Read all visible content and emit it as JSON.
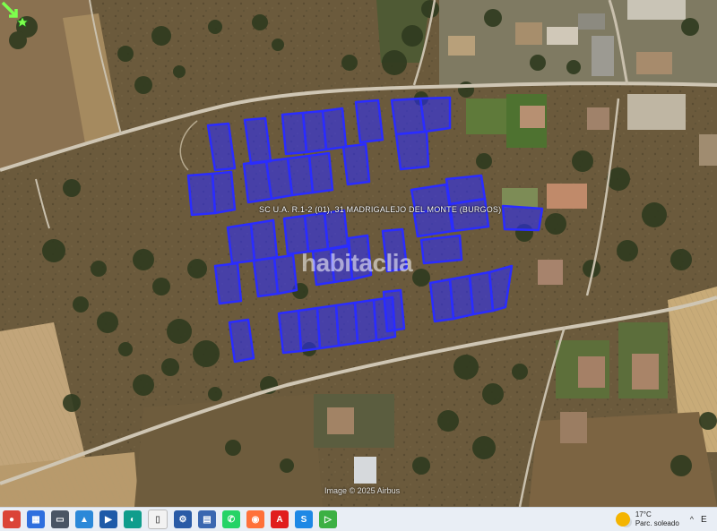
{
  "map": {
    "parcel_label": "SC U.A. R.1-2 (01), 31  MADRIGALEJO DEL MONTE (BURGOS)",
    "watermark": "habitaclia",
    "copyright": "Image © 2025 Airbus",
    "parcel_color": "#2a2cff",
    "marker_color": "#7dff4d"
  },
  "taskbar": {
    "apps": [
      {
        "name": "chrome-icon",
        "color": "#db4437"
      },
      {
        "name": "calendar-icon",
        "color": "#2f6fde"
      },
      {
        "name": "window-icon",
        "color": "#4a5564"
      },
      {
        "name": "photos-icon",
        "color": "#2b88d8"
      },
      {
        "name": "media-icon",
        "color": "#1e5aa8"
      },
      {
        "name": "edge-icon",
        "color": "#0f9d8c"
      },
      {
        "name": "document-icon",
        "color": "#f2f2f2"
      },
      {
        "name": "gear-icon",
        "color": "#2a5ba6"
      },
      {
        "name": "save-icon",
        "color": "#3a67b0"
      },
      {
        "name": "whatsapp-icon",
        "color": "#25d366"
      },
      {
        "name": "firefox-icon",
        "color": "#ff7139"
      },
      {
        "name": "acrobat-icon",
        "color": "#e11d1d"
      },
      {
        "name": "s-app-icon",
        "color": "#1e88e5"
      },
      {
        "name": "play-app-icon",
        "color": "#3cb043"
      }
    ],
    "weather_temp": "17°C",
    "weather_desc": "Parc. soleado",
    "clock_partial": "E"
  }
}
